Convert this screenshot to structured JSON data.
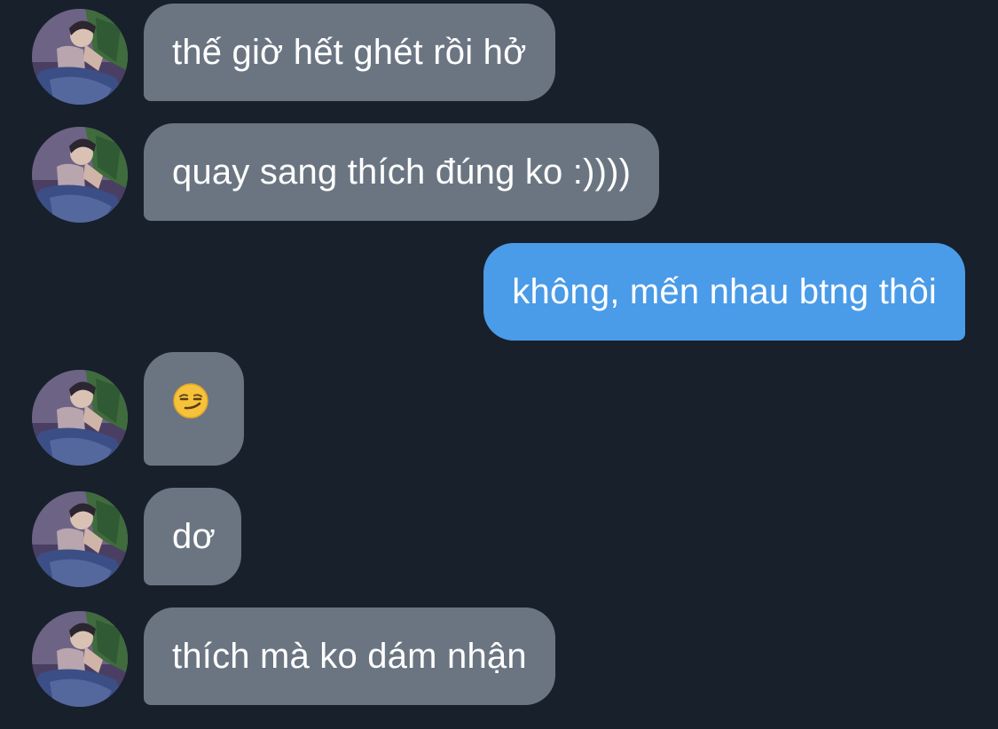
{
  "conversation": {
    "messages": [
      {
        "sender": "contact",
        "text": "thế giờ hết ghét rồi hở"
      },
      {
        "sender": "contact",
        "text": "quay sang thích đúng ko :))))"
      },
      {
        "sender": "me",
        "text": "không, mến nhau btng thôi"
      },
      {
        "sender": "contact",
        "emoji": "smirking-face-icon"
      },
      {
        "sender": "contact",
        "text": "dơ"
      },
      {
        "sender": "contact",
        "text": "thích mà ko dám nhận"
      }
    ]
  },
  "colors": {
    "background": "#18202b",
    "incoming_bubble": "#6b7582",
    "outgoing_bubble": "#4a9be8",
    "text": "#ffffff"
  }
}
